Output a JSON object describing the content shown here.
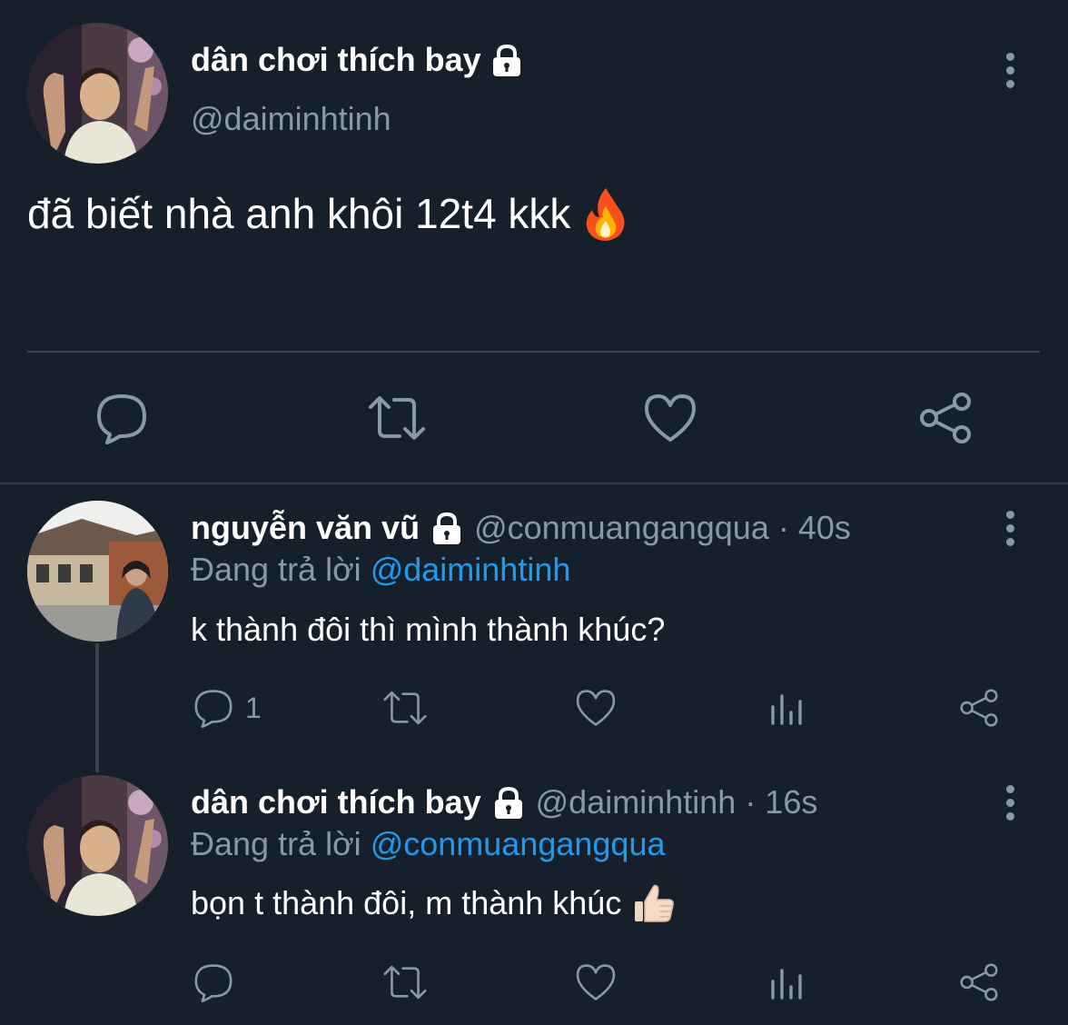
{
  "main_tweet": {
    "display_name": "dân chơi thích bay",
    "handle": "@daiminhtinh",
    "text": "đã biết nhà anh khôi 12t4 kkk",
    "emoji": "🔥",
    "avatar_icon": "avatar-photo-man-raised-arm"
  },
  "replies": [
    {
      "display_name": "nguyễn văn vũ",
      "handle": "@conmuangangqua",
      "time": "· 40s",
      "replying_label": "Đang trả lời",
      "replying_to": "@daiminhtinh",
      "text": "k thành đôi thì mình thành khúc?",
      "emoji": "",
      "reply_count": "1",
      "avatar_icon": "avatar-photo-street-houses"
    },
    {
      "display_name": "dân chơi thích bay",
      "handle": "@daiminhtinh",
      "time": "· 16s",
      "replying_label": "Đang trả lời",
      "replying_to": "@conmuangangqua",
      "text": "bọn t thành đôi, m thành khúc",
      "emoji": "👍🏻",
      "reply_count": "",
      "avatar_icon": "avatar-photo-man-raised-arm"
    }
  ],
  "colors": {
    "background": "#15202b",
    "muted": "#8899a6",
    "link": "#1d9bf0",
    "divider": "#38444d"
  }
}
